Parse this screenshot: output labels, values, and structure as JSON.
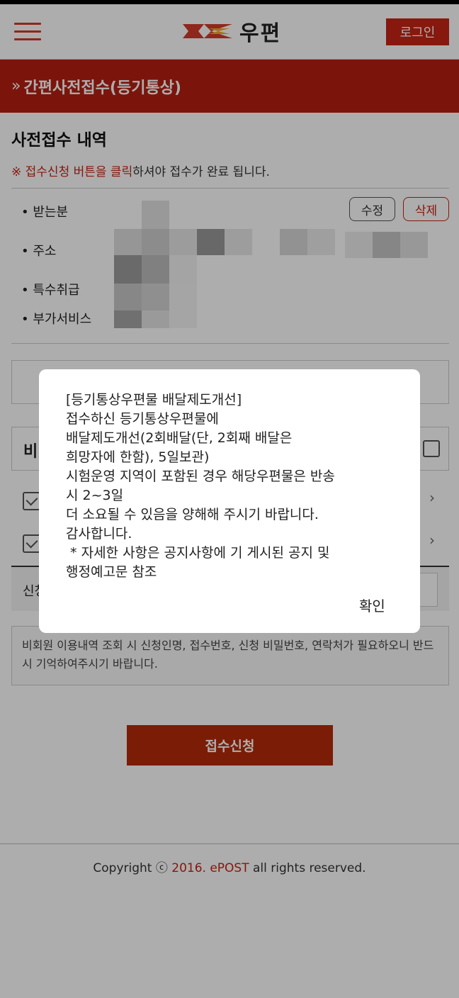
{
  "header": {
    "logo_text": "우편",
    "login_label": "로그인"
  },
  "titlebar": {
    "chevron": "»",
    "title": "간편사전접수(등기통상)"
  },
  "section": {
    "title": "사전접수 내역",
    "notice_red": "※ 접수신청 버튼을 클릭",
    "notice_rest": "하셔야 접수가 완료 됩니다."
  },
  "entry": {
    "labels": [
      "받는분",
      "주소",
      "특수취급",
      "부가서비스"
    ],
    "edit_label": "수정",
    "delete_label": "삭제"
  },
  "agreement": {
    "row_label": "비"
  },
  "password_row": {
    "label": "신청"
  },
  "info_notice": "비회원 이용내역 조회 시 신청인명, 접수번호, 신청 비밀번호, 연락처가 필요하오니 반드시 기억하여주시기 바랍니다.",
  "submit_label": "접수신청",
  "footer": {
    "copyright_prefix": "Copyright ⓒ ",
    "copyright_red": "2016. ePOST",
    "copyright_suffix": " all rights reserved."
  },
  "modal": {
    "message": "[등기통상우편물 배달제도개선]\n접수하신 등기통상우편물에\n배달제도개선(2회배달(단, 2회째 배달은\n희망자에 한함), 5일보관)\n시험운영 지역이 포함된 경우 해당우편물은 반송\n시 2~3일\n더 소요될 수 있음을 양해해 주시기 바랍니다.\n감사합니다.\n * 자세한 사항은 공지사항에 기 게시된 공지 및\n행정예고문 참조",
    "confirm_label": "확인"
  },
  "colors": {
    "brand_red": "#c62414",
    "title_red": "#b51f12",
    "submit": "#b52a0a"
  },
  "icons": [
    "hamburger-menu-icon",
    "epost-logo-icon",
    "chevron-right-icon",
    "checkbox-icon"
  ]
}
